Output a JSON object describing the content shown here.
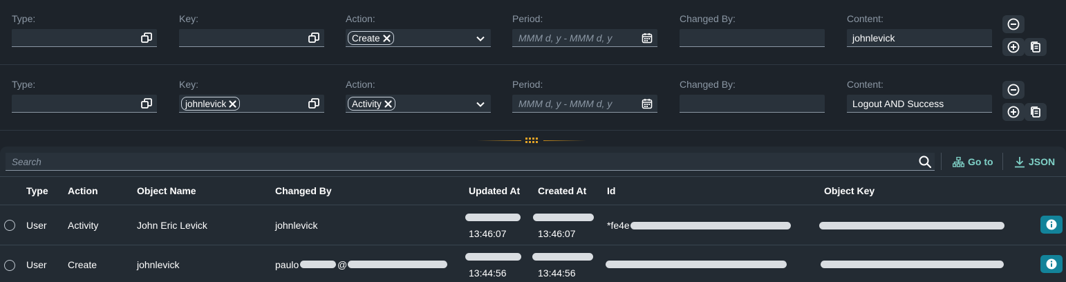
{
  "filters": {
    "labels": {
      "type": "Type:",
      "key": "Key:",
      "action": "Action:",
      "period": "Period:",
      "changed_by": "Changed By:",
      "content": "Content:"
    },
    "rows": [
      {
        "type_value": "",
        "key_token": "",
        "action_token": "Create",
        "period_placeholder": "MMM d, y - MMM d, y",
        "changed_by_value": "",
        "content_value": "johnlevick"
      },
      {
        "type_value": "",
        "key_token": "johnlevick",
        "action_token": "Activity",
        "period_placeholder": "MMM d, y - MMM d, y",
        "changed_by_value": "",
        "content_value": "Logout AND Success"
      }
    ]
  },
  "search": {
    "placeholder": "Search"
  },
  "toolbar": {
    "goto_label": "Go to",
    "json_label": "JSON"
  },
  "table": {
    "columns": [
      "Type",
      "Action",
      "Object Name",
      "Changed By",
      "Updated At",
      "Created At",
      "Id",
      "Object Key"
    ],
    "rows": [
      {
        "type": "User",
        "action": "Activity",
        "object_name": "John Eric Levick",
        "changed_by": "johnlevick",
        "updated_at_time": "13:46:07",
        "created_at_time": "13:46:07",
        "id_prefix": "*fe4e"
      },
      {
        "type": "User",
        "action": "Create",
        "object_name": "johnlevick",
        "changed_by_prefix": "paulo",
        "changed_by_at": "@",
        "updated_at_time": "13:44:56",
        "created_at_time": "13:44:56"
      }
    ]
  },
  "colors": {
    "background": "#1d232a",
    "panel": "#232b33",
    "accent_teal": "#7fd1c7",
    "info_button": "#13839a",
    "splitter": "#c58a1a"
  }
}
